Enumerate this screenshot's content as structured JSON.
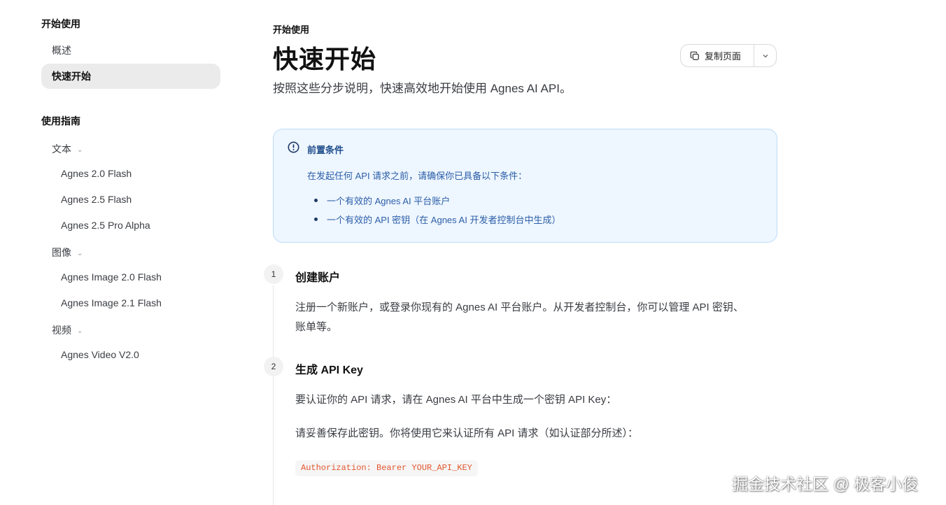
{
  "sidebar": {
    "section_start": "开始使用",
    "item_overview": "概述",
    "item_quickstart": "快速开始",
    "section_guide": "使用指南",
    "groups": {
      "text": {
        "label": "文本",
        "items": [
          "Agnes 2.0 Flash",
          "Agnes 2.5 Flash",
          "Agnes 2.5 Pro Alpha"
        ]
      },
      "image": {
        "label": "图像",
        "items": [
          "Agnes Image 2.0 Flash",
          "Agnes Image 2.1 Flash"
        ]
      },
      "video": {
        "label": "视频",
        "items": [
          "Agnes Video V2.0"
        ]
      }
    },
    "chevron": "chevron-down-icon"
  },
  "header": {
    "breadcrumb": "开始使用",
    "title": "快速开始",
    "subtitle": "按照这些分步说明，快速高效地开始使用 Agnes AI API。",
    "copy_label": "复制页面",
    "copy_icon": "copy-icon",
    "dropdown_icon": "chevron-down-icon"
  },
  "callout": {
    "icon": "info-icon",
    "title": "前置条件",
    "body": "在发起任何 API 请求之前，请确保你已具备以下条件：",
    "items": [
      "一个有效的 Agnes AI 平台账户",
      "一个有效的 API 密钥（在 Agnes AI 开发者控制台中生成）"
    ]
  },
  "steps": [
    {
      "number": "1",
      "title": "创建账户",
      "paragraphs": [
        "注册一个新账户，或登录你现有的 Agnes AI 平台账户。从开发者控制台，你可以管理 API 密钥、",
        "账单等。"
      ]
    },
    {
      "number": "2",
      "title": "生成 API Key",
      "paragraphs": [
        "要认证你的 API 请求，请在 Agnes AI 平台中生成一个密钥 API Key：",
        "请妥善保存此密钥。你将使用它来认证所有 API 请求（如认证部分所述）："
      ],
      "code": "Authorization: Bearer YOUR_API_KEY"
    }
  ],
  "watermark": "掘金技术社区 @ 极客小俊",
  "colors": {
    "callout_bg": "#eef6ff",
    "callout_border": "#bcdcf8",
    "callout_text": "#2b5ea8",
    "code_text": "#e4572e",
    "active_bg": "#ebebeb"
  }
}
